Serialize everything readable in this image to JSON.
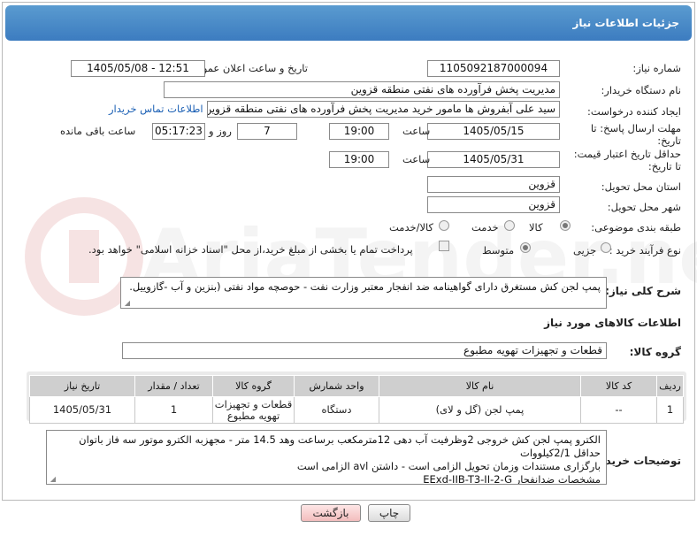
{
  "header": {
    "title": "جزئیات اطلاعات نیاز"
  },
  "fields": {
    "need_number_label": "شماره نیاز:",
    "need_number": "1105092187000094",
    "announce_label": "تاریخ و ساعت اعلان عمومی:",
    "announce_value": "1405/05/08 - 12:51",
    "buyer_org_label": "نام دستگاه خریدار:",
    "buyer_org": "مدیریت پخش فرآورده های نفتی منطقه قزوین",
    "creator_label": "ایجاد کننده درخواست:",
    "creator": "سید علی  آبفروش ها مامور خرید مدیریت پخش فرآورده های نفتی منطقه قزوین",
    "contact_link": "اطلاعات تماس خریدار",
    "deadline_label": "مهلت ارسال پاسخ: تا تاریخ:",
    "deadline_date": "1405/05/15",
    "time_label": "ساعت",
    "deadline_time": "19:00",
    "days_value": "7",
    "days_label": "روز و",
    "remaining_time": "05:17:23",
    "remaining_label": "ساعت باقی مانده",
    "validity_label": "حداقل تاریخ اعتبار قیمت: تا تاریخ:",
    "validity_date": "1405/05/31",
    "validity_time": "19:00",
    "province_label": "استان محل تحویل:",
    "province": "قزوین",
    "city_label": "شهر محل تحویل:",
    "city": "قزوین",
    "category_label": "طبقه بندی موضوعی:",
    "category_options": [
      "کالا",
      "خدمت",
      "کالا/خدمت"
    ],
    "process_label": "نوع فرآیند خرید :",
    "process_options": [
      "جزیی",
      "متوسط"
    ],
    "payment_note": "پرداخت تمام یا بخشی از مبلغ خرید،از محل \"اسناد خزانه اسلامی\" خواهد بود."
  },
  "description": {
    "label": "شرح کلی نیاز:",
    "text": "پمپ لجن  کش مستغرق دارای گواهینامه ضد انفجار معتبر وزارت نفت - حوصچه مواد نفتی (بنزین و آب -گازوییل."
  },
  "goods": {
    "section_title": "اطلاعات کالاهای مورد نیاز",
    "group_label": "گروه کالا:",
    "group_value": "قطعات و تجهیزات تهویه مطبوع",
    "columns": [
      "ردیف",
      "کد کالا",
      "نام کالا",
      "واحد شمارش",
      "گروه کالا",
      "تعداد / مقدار",
      "تاریخ نیاز"
    ],
    "rows": [
      {
        "row": "1",
        "code": "--",
        "name": "پمپ لجن (گل و لای)",
        "unit": "دستگاه",
        "group": "قطعات و تجهیزات تهویه مطبوع",
        "qty": "1",
        "date": "1405/05/31"
      }
    ]
  },
  "buyer_notes": {
    "label": "توضیحات خریدار:",
    "line1": "الکترو پمپ لجن کش خروجی 2وظرفیت آب دهی 12مترمکعب برساعت وهد 14.5 متر - مجهزبه الکترو موتور سه فاز باتوان حداقل 2/1کیلووات",
    "line2": "بارگزاری مستندات وزمان تحویل الزامی است - داشتن avl الزامی است",
    "line3": "مشخصات ضدانفجار EExd-IIB-T3-II-2-G"
  },
  "buttons": {
    "print": "چاپ",
    "back": "بازگشت"
  },
  "watermark": {
    "text": "AriaTender.net"
  },
  "colors": {
    "title_bar": "#3c7cc0",
    "link": "#1a5fb4",
    "back_button": "#f3bdbd"
  }
}
